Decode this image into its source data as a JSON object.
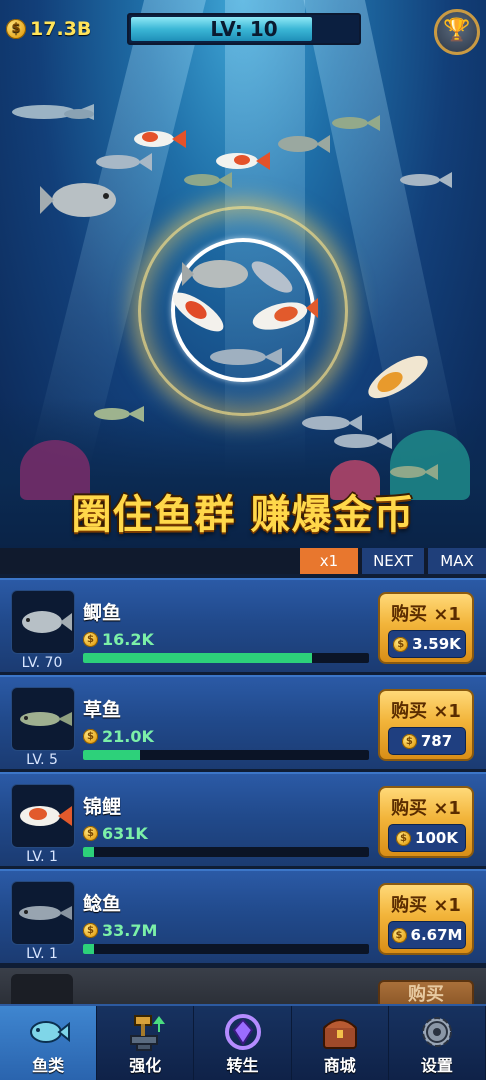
{
  "header": {
    "gold": "17.3B",
    "level_label": "LV: 10",
    "level_progress": 0.8
  },
  "headline": "圈住鱼群 赚爆金币",
  "multiplier": {
    "x1": "x1",
    "next": "NEXT",
    "max": "MAX",
    "selected": "x1"
  },
  "fish_list": [
    {
      "name": "鲫鱼",
      "level": "LV. 70",
      "income": "16.2K",
      "progress": 0.8,
      "buy_label": "购买 ×1",
      "price": "3.59K",
      "color": "#9aa4ad"
    },
    {
      "name": "草鱼",
      "level": "LV. 5",
      "income": "21.0K",
      "progress": 0.2,
      "buy_label": "购买 ×1",
      "price": "787",
      "color": "#8fa07a"
    },
    {
      "name": "锦鲤",
      "level": "LV. 1",
      "income": "631K",
      "progress": 0.04,
      "buy_label": "购买 ×1",
      "price": "100K",
      "color": "#e25a2c"
    },
    {
      "name": "鲶鱼",
      "level": "LV. 1",
      "income": "33.7M",
      "progress": 0.04,
      "buy_label": "购买 ×1",
      "price": "6.67M",
      "color": "#8c97a3"
    }
  ],
  "locked_buy_label": "购买",
  "nav": [
    {
      "label": "鱼类",
      "icon": "fish-icon",
      "active": true
    },
    {
      "label": "强化",
      "icon": "anvil-hammer-icon",
      "active": false
    },
    {
      "label": "转生",
      "icon": "rebirth-crystal-icon",
      "active": false
    },
    {
      "label": "商城",
      "icon": "treasure-chest-icon",
      "active": false
    },
    {
      "label": "设置",
      "icon": "gear-icon",
      "active": false
    }
  ],
  "colors": {
    "gold": "#ffd84a",
    "accent_orange": "#e8772e",
    "progress_green": "#2dd17a",
    "level_cyan": "#3bb7d6"
  }
}
